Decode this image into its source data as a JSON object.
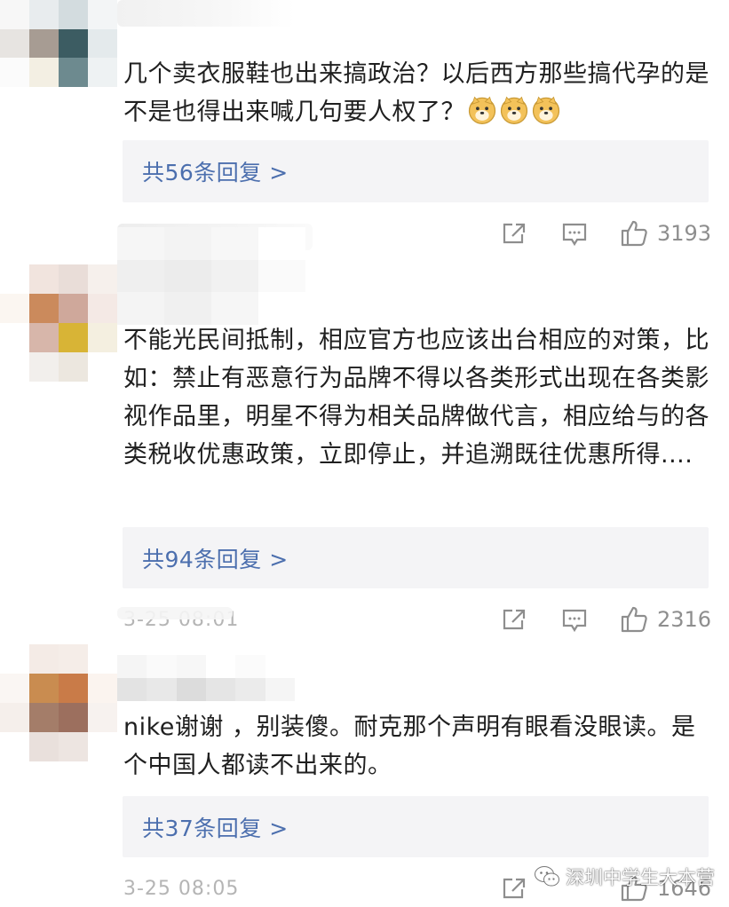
{
  "comments": [
    {
      "text": "几个卖衣服鞋也出来搞政治？以后西方那些搞代孕的是不是也得出来喊几句要人权了？",
      "emoji": [
        "doge-emoji",
        "doge-emoji",
        "doge-emoji"
      ],
      "replies_label": "共56条回复 >",
      "time": "",
      "likes": "3193"
    },
    {
      "text": "不能光民间抵制，相应官方也应该出台相应的对策，比如：禁止有恶意行为品牌不得以各类形式出现在各类影视作品里，明星不得为相关品牌做代言，相应给与的各类税收优惠政策，立即停止，并追溯既往优惠所得....",
      "replies_label": "共94条回复 >",
      "time": "3-25 08:01",
      "likes": "2316"
    },
    {
      "text": "nike谢谢 ，别装傻。耐克那个声明有眼看没眼读。是个中国人都读不出来的。",
      "replies_label": "共37条回复 >",
      "time": "3-25 08:05",
      "likes": "1646"
    }
  ],
  "watermark": {
    "text": "深圳中学生大本营"
  },
  "colors": {
    "link": "#4c6fae",
    "muted": "#8e8e8e",
    "reply_bg": "#f4f4f6"
  }
}
